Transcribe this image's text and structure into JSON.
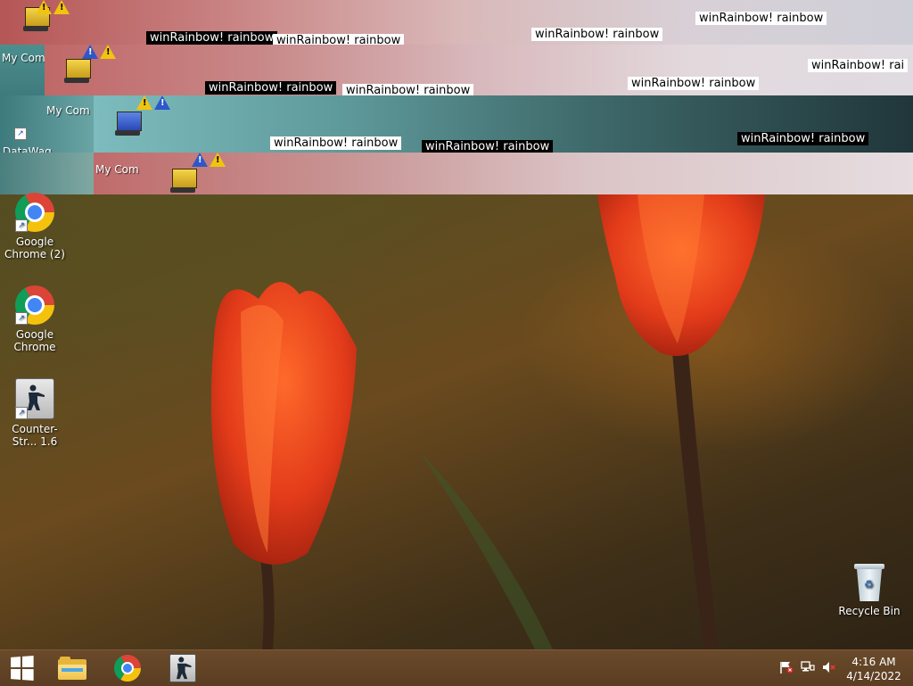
{
  "glitch": {
    "labels": [
      "winRainbow! rainbow",
      "winRainbow! rainbow",
      "winRainbow! rainbow",
      "winRainbow! rainbow",
      "winRainbow! rai",
      "winRainbow! rainbow",
      "winRainbow! rainbow",
      "winRainbow! rainbow",
      "winRainbow! rainbow",
      "winRainbow! rainbow",
      "winRainbow! rainbow"
    ],
    "captions": [
      "My Com",
      "My Com",
      "My Com",
      "DataWag"
    ]
  },
  "desktop_icons": {
    "chrome2": "Google Chrome (2)",
    "chrome": "Google Chrome",
    "counter_strike": "Counter-Str... 1.6",
    "recycle_bin": "Recycle Bin"
  },
  "taskbar": {
    "start": "Start",
    "pinned": [
      "File Explorer",
      "Google Chrome",
      "Counter-Strike 1.6"
    ]
  },
  "tray": {
    "time": "4:16 AM",
    "date": "4/14/2022"
  },
  "icons": {
    "start": "windows-logo-icon",
    "explorer": "folder-icon",
    "chrome": "chrome-icon",
    "cs": "counter-strike-icon",
    "flag": "action-center-flag-icon",
    "network": "network-icon",
    "volume": "volume-muted-icon"
  },
  "colors": {
    "taskbar": "#5f4226",
    "accent_red": "#e23b1a"
  }
}
